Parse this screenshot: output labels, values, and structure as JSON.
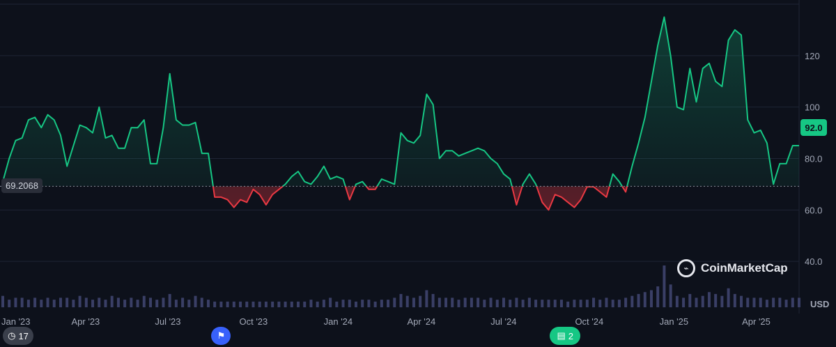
{
  "chart_data": {
    "type": "area",
    "currency": "USD",
    "baseline": 69.2068,
    "baseline_label": "69.2068",
    "last_value_label": "92.0",
    "ylim": [
      20,
      140
    ],
    "y_ticks": [
      "40.0",
      "60.0",
      "80.0",
      "100",
      "120"
    ],
    "y_tick_values": [
      40,
      60,
      80,
      100,
      120
    ],
    "x_ticks": [
      "Jan '23",
      "Apr '23",
      "Jul '23",
      "Oct '23",
      "Jan '24",
      "Apr '24",
      "Jul '24",
      "Oct '24",
      "Jan '25",
      "Apr '25"
    ],
    "x_tick_dates": [
      "2023-01-01",
      "2023-04-01",
      "2023-07-01",
      "2023-10-01",
      "2024-01-01",
      "2024-04-01",
      "2024-07-01",
      "2024-10-01",
      "2025-01-01",
      "2025-04-01"
    ],
    "series": [
      {
        "dates": [
          "2023-01-01",
          "2023-01-08",
          "2023-01-15",
          "2023-01-22",
          "2023-01-29",
          "2023-02-05",
          "2023-02-12",
          "2023-02-19",
          "2023-02-26",
          "2023-03-05",
          "2023-03-12",
          "2023-03-19",
          "2023-03-26",
          "2023-04-02",
          "2023-04-09",
          "2023-04-16",
          "2023-04-23",
          "2023-04-30",
          "2023-05-07",
          "2023-05-14",
          "2023-05-21",
          "2023-05-28",
          "2023-06-04",
          "2023-06-11",
          "2023-06-18",
          "2023-06-25",
          "2023-07-02",
          "2023-07-09",
          "2023-07-16",
          "2023-07-23",
          "2023-07-30",
          "2023-08-06",
          "2023-08-13",
          "2023-08-20",
          "2023-08-27",
          "2023-09-03",
          "2023-09-10",
          "2023-09-17",
          "2023-09-24",
          "2023-10-01",
          "2023-10-08",
          "2023-10-15",
          "2023-10-22",
          "2023-10-29",
          "2023-11-05",
          "2023-11-12",
          "2023-11-19",
          "2023-11-26",
          "2023-12-03",
          "2023-12-10",
          "2023-12-17",
          "2023-12-24",
          "2023-12-31",
          "2024-01-07",
          "2024-01-14",
          "2024-01-21",
          "2024-01-28",
          "2024-02-04",
          "2024-02-11",
          "2024-02-18",
          "2024-02-25",
          "2024-03-03",
          "2024-03-10",
          "2024-03-17",
          "2024-03-24",
          "2024-03-31",
          "2024-04-07",
          "2024-04-14",
          "2024-04-21",
          "2024-04-28",
          "2024-05-05",
          "2024-05-12",
          "2024-05-19",
          "2024-05-26",
          "2024-06-02",
          "2024-06-09",
          "2024-06-16",
          "2024-06-23",
          "2024-06-30",
          "2024-07-07",
          "2024-07-14",
          "2024-07-21",
          "2024-07-28",
          "2024-08-04",
          "2024-08-11",
          "2024-08-18",
          "2024-08-25",
          "2024-09-01",
          "2024-09-08",
          "2024-09-15",
          "2024-09-22",
          "2024-09-29",
          "2024-10-06",
          "2024-10-13",
          "2024-10-20",
          "2024-10-27",
          "2024-11-03",
          "2024-11-10",
          "2024-11-17",
          "2024-11-24",
          "2024-12-01",
          "2024-12-08",
          "2024-12-15",
          "2024-12-22",
          "2024-12-29",
          "2025-01-05",
          "2025-01-12",
          "2025-01-19",
          "2025-01-26",
          "2025-02-02",
          "2025-02-09",
          "2025-02-16",
          "2025-02-23",
          "2025-03-02",
          "2025-03-09",
          "2025-03-16",
          "2025-03-23",
          "2025-03-30",
          "2025-04-06",
          "2025-04-13",
          "2025-04-20",
          "2025-04-27",
          "2025-05-04",
          "2025-05-11",
          "2025-05-18"
        ],
        "values": [
          71,
          80,
          87,
          88,
          95,
          96,
          92,
          97,
          95,
          89,
          77,
          85,
          93,
          92,
          90,
          100,
          88,
          89,
          84,
          84,
          92,
          92,
          95,
          78,
          78,
          92,
          113,
          95,
          93,
          93,
          94,
          82,
          82,
          65,
          65,
          64,
          61,
          64,
          63,
          68,
          66,
          62,
          66,
          68,
          70,
          73,
          75,
          71,
          70,
          73,
          77,
          72,
          73,
          72,
          64,
          70,
          71,
          68,
          68,
          72,
          71,
          70,
          90,
          87,
          86,
          89,
          105,
          101,
          80,
          83,
          83,
          81,
          82,
          83,
          84,
          83,
          80,
          78,
          74,
          72,
          62,
          70,
          74,
          70,
          63,
          60,
          66,
          65,
          63,
          61,
          64,
          69,
          69,
          67,
          65,
          74,
          71,
          67,
          77,
          86,
          96,
          110,
          124,
          135,
          120,
          100,
          99,
          115,
          102,
          115,
          117,
          110,
          108,
          126,
          130,
          128,
          95,
          90,
          91,
          86,
          70,
          78,
          78,
          85,
          85,
          92
        ]
      }
    ],
    "volume": [
      6,
      4,
      5,
      5,
      4,
      5,
      4,
      5,
      4,
      5,
      5,
      4,
      6,
      5,
      4,
      5,
      4,
      6,
      5,
      4,
      5,
      4,
      6,
      5,
      4,
      5,
      7,
      4,
      5,
      4,
      6,
      5,
      4,
      3,
      3,
      3,
      3,
      3,
      3,
      3,
      3,
      3,
      3,
      3,
      3,
      3,
      3,
      3,
      4,
      3,
      4,
      5,
      3,
      4,
      4,
      3,
      4,
      4,
      3,
      4,
      4,
      5,
      7,
      6,
      5,
      6,
      9,
      7,
      5,
      5,
      5,
      4,
      5,
      5,
      5,
      4,
      5,
      4,
      5,
      4,
      5,
      4,
      5,
      4,
      4,
      4,
      4,
      4,
      3,
      4,
      4,
      4,
      5,
      4,
      5,
      4,
      4,
      5,
      6,
      7,
      8,
      9,
      11,
      22,
      12,
      6,
      5,
      7,
      5,
      6,
      8,
      7,
      6,
      10,
      7,
      6,
      5,
      5,
      5,
      4,
      5,
      5,
      4,
      5,
      5,
      6
    ],
    "events": [
      {
        "label": "17",
        "icon": "history-icon",
        "date": "2023-01-10"
      },
      {
        "label": "",
        "icon": "flag-icon",
        "date": "2023-08-27"
      },
      {
        "label": "2",
        "icon": "document-icon",
        "date": "2024-09-05"
      }
    ]
  },
  "brand": {
    "name": "CoinMarketCap"
  },
  "colors": {
    "up": "#16c784",
    "down": "#ea3943",
    "background": "#0d111b",
    "grid": "#1e2535",
    "volume": "#3a3f66"
  }
}
